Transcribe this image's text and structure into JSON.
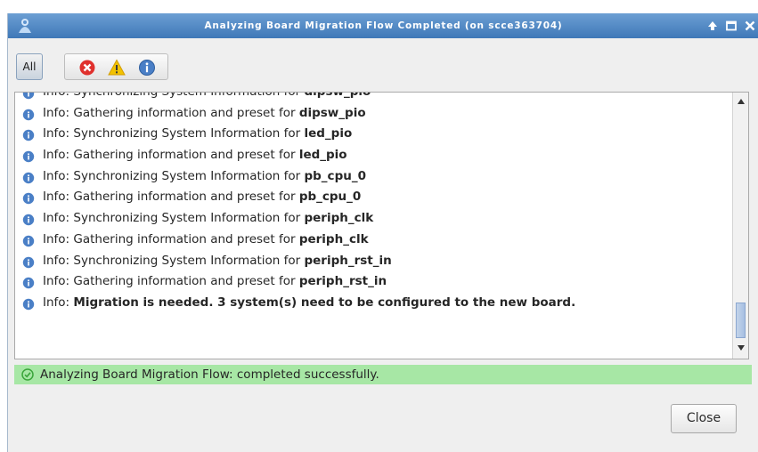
{
  "window": {
    "title": "Analyzing Board Migration Flow Completed (on scce363704)",
    "titlebar_buttons": [
      {
        "icon": "arrow-up-icon",
        "glyph": "↑"
      },
      {
        "icon": "maximize-icon",
        "glyph": "□"
      },
      {
        "icon": "close-icon",
        "glyph": "×"
      }
    ]
  },
  "toolbar": {
    "all_label": "All",
    "filters": [
      {
        "icon": "error-filter-icon",
        "color": "#e0312d"
      },
      {
        "icon": "warning-filter-icon",
        "color": "#f2c200"
      },
      {
        "icon": "info-filter-icon",
        "color": "#4a7fc6"
      }
    ]
  },
  "log": {
    "prefix": "Info: ",
    "lines": [
      {
        "text": "Synchronizing System Information for ",
        "bold": "dipsw_pio"
      },
      {
        "text": "Gathering information and preset for ",
        "bold": "dipsw_pio"
      },
      {
        "text": "Synchronizing System Information for ",
        "bold": "led_pio"
      },
      {
        "text": "Gathering information and preset for ",
        "bold": "led_pio"
      },
      {
        "text": "Synchronizing System Information for ",
        "bold": "pb_cpu_0"
      },
      {
        "text": "Gathering information and preset for ",
        "bold": "pb_cpu_0"
      },
      {
        "text": "Synchronizing System Information for ",
        "bold": "periph_clk"
      },
      {
        "text": "Gathering information and preset for ",
        "bold": "periph_clk"
      },
      {
        "text": "Synchronizing System Information for ",
        "bold": "periph_rst_in"
      },
      {
        "text": "Gathering information and preset for ",
        "bold": "periph_rst_in"
      },
      {
        "text": "",
        "bold": "Migration is needed. 3 system(s) need to be configured to the new board."
      }
    ]
  },
  "status": {
    "text": "Analyzing Board Migration Flow: completed successfully.",
    "color": "#a7e7a5"
  },
  "footer": {
    "close_label": "Close"
  },
  "colors": {
    "titlebar": "#4a82c0",
    "info_icon": "#4a7fc6",
    "success_icon": "#3aa53a"
  }
}
